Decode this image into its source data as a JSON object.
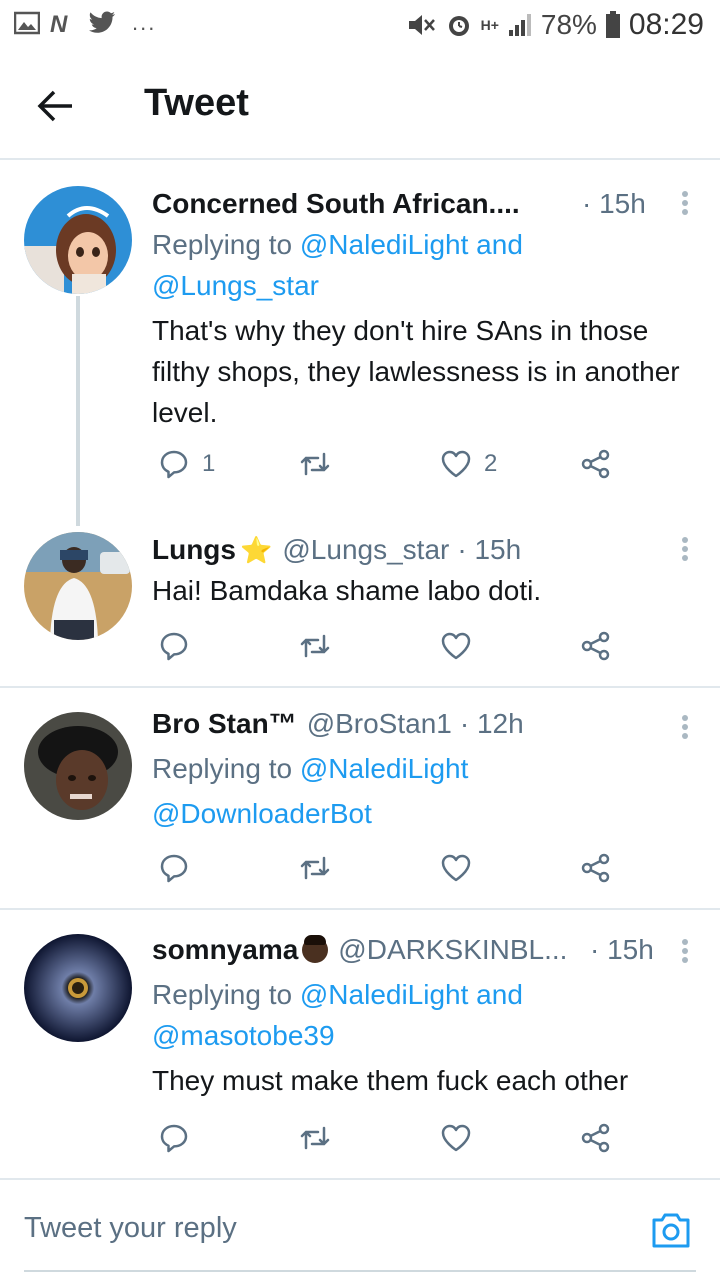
{
  "status_bar": {
    "battery": "78%",
    "time": "08:29",
    "network": "H+",
    "more": "..."
  },
  "header": {
    "title": "Tweet"
  },
  "tweets": [
    {
      "name": "Concerned South African....",
      "handle": "",
      "time": "· 15h",
      "replying_prefix": "Replying to ",
      "replying_line1": "@NalediLight and",
      "replying_line2": "@Lungs_star",
      "text": "That's why they don't hire SAns in those filthy shops, they lawlessness is in another level.",
      "replies": "1",
      "likes": "2"
    },
    {
      "name": "Lungs",
      "name_emoji": "⭐",
      "handle": "@Lungs_star",
      "time": "· 15h",
      "text": "Hai! Bamdaka shame labo doti."
    },
    {
      "name": "Bro Stan™",
      "handle": "@BroStan1",
      "time": "· 12h",
      "replying_prefix": "Replying to ",
      "replying_line1": "@NalediLight",
      "replying_line2": "@DownloaderBot"
    },
    {
      "name": "somnyama",
      "handle": "@DARKSKINBL...",
      "time": "· 15h",
      "replying_prefix": "Replying to ",
      "replying_line1": "@NalediLight and",
      "replying_line2": "@masotobe39",
      "text": "They must make them fuck each other"
    }
  ],
  "reply_box": {
    "placeholder": "Tweet your reply"
  },
  "colors": {
    "accent": "#1d9bf0",
    "secondary_text": "#5b7083",
    "divider": "#e1e8ed"
  }
}
